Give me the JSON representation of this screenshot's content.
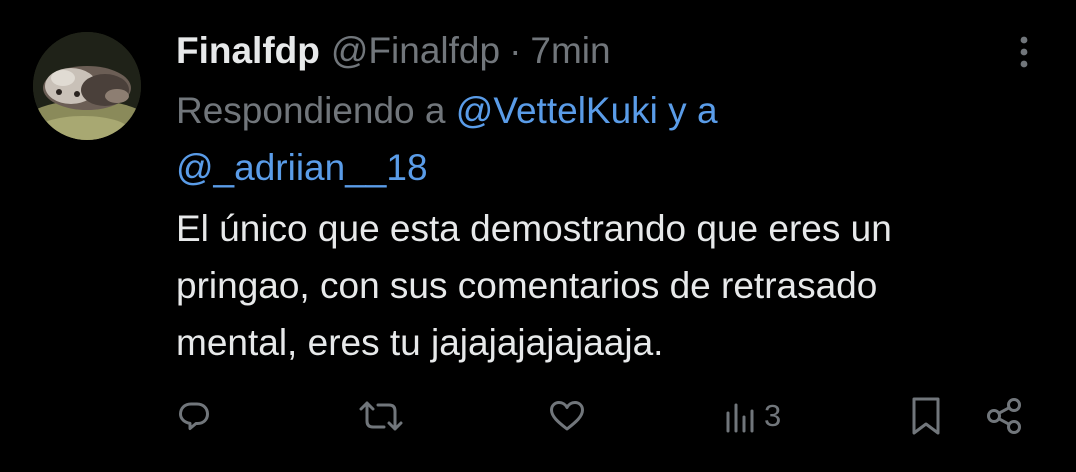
{
  "tweet": {
    "display_name": "Finalfdp",
    "handle": "@Finalfdp",
    "separator": "·",
    "time": "7min",
    "reply_prefix": "Respondiendo a ",
    "reply_mention_1": "@VettelKuki",
    "reply_conjunction": " y a",
    "reply_mention_2": "@_adriian__18",
    "lines": [
      "El único que esta demostrando que eres un",
      "pringao, con sus comentarios de retrasado",
      "mental, eres tu jajajajajajaaja."
    ],
    "views": "3"
  },
  "icons": {
    "more": "more-vertical-icon",
    "reply": "reply-icon",
    "retweet": "retweet-icon",
    "like": "heart-icon",
    "views": "analytics-icon",
    "bookmark": "bookmark-icon",
    "share": "share-icon"
  },
  "colors": {
    "background": "#000000",
    "primary_text": "#e7e9ea",
    "secondary_text": "#71767b",
    "link": "#5a9ce8"
  }
}
